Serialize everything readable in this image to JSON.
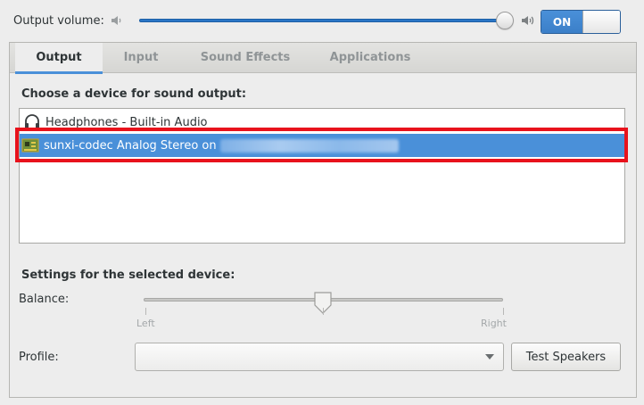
{
  "top": {
    "volume_label": "Output volume:",
    "volume_level": 0.99,
    "switch_label": "ON"
  },
  "tabs": [
    "Output",
    "Input",
    "Sound Effects",
    "Applications"
  ],
  "output": {
    "choose_label": "Choose a device for sound output:",
    "devices": [
      {
        "label": "Headphones - Built-in Audio",
        "icon": "headphones-icon",
        "selected": false
      },
      {
        "label": "sunxi-codec Analog Stereo on",
        "icon": "audio-card-icon",
        "selected": true
      }
    ],
    "settings_label": "Settings for the selected device:",
    "balance_label": "Balance:",
    "balance_left": "Left",
    "balance_right": "Right",
    "balance_value": 0.5,
    "profile_label": "Profile:",
    "profile_value": "",
    "test_button": "Test Speakers"
  },
  "colors": {
    "accent": "#4a90d9",
    "highlight_box": "#e8121c"
  }
}
